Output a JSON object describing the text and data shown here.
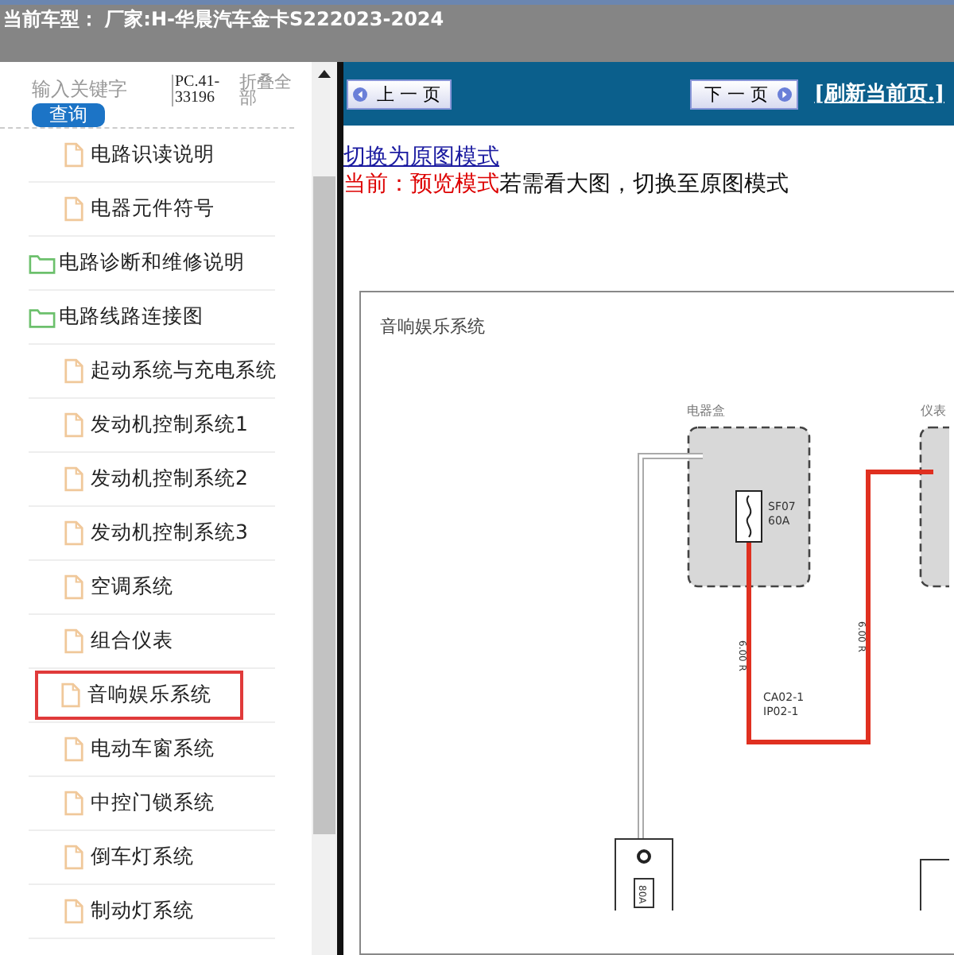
{
  "header": {
    "title": "当前车型： 厂家:H-华晨汽车金卡S222023-2024"
  },
  "sidebar": {
    "search": {
      "placeholder": "输入关键字",
      "button": "查询"
    },
    "code": "PC.41-33196",
    "collapse_all": "折叠全部",
    "tree": [
      {
        "kind": "file",
        "label": "电路识读说明",
        "selected": false
      },
      {
        "kind": "file",
        "label": "电器元件符号",
        "selected": false
      },
      {
        "kind": "folder",
        "label": "电路诊断和维修说明",
        "selected": false
      },
      {
        "kind": "folder",
        "label": "电路线路连接图",
        "selected": false,
        "children": [
          {
            "kind": "file",
            "label": "起动系统与充电系统",
            "selected": false
          },
          {
            "kind": "file",
            "label": "发动机控制系统1",
            "selected": false
          },
          {
            "kind": "file",
            "label": "发动机控制系统2",
            "selected": false
          },
          {
            "kind": "file",
            "label": "发动机控制系统3",
            "selected": false
          },
          {
            "kind": "file",
            "label": "空调系统",
            "selected": false
          },
          {
            "kind": "file",
            "label": "组合仪表",
            "selected": false
          },
          {
            "kind": "file",
            "label": "音响娱乐系统",
            "selected": true
          },
          {
            "kind": "file",
            "label": "电动车窗系统",
            "selected": false
          },
          {
            "kind": "file",
            "label": "中控门锁系统",
            "selected": false
          },
          {
            "kind": "file",
            "label": "倒车灯系统",
            "selected": false
          },
          {
            "kind": "file",
            "label": "制动灯系统",
            "selected": false
          }
        ]
      }
    ]
  },
  "toolbar": {
    "prev": "上 一 页",
    "next": "下 一 页",
    "refresh": "[刷新当前页.]"
  },
  "mode": {
    "switch_link": "切换为原图模式",
    "current": "当前：预览模式",
    "hint": "若需看大图，切换至原图模式"
  },
  "diagram": {
    "title": "音响娱乐系统",
    "box_1": "电器盒",
    "box_2": "仪表",
    "fuse": "SF07",
    "fuse_rating": "60A",
    "wire_1": "6.00 R",
    "wire_2": "6.00 R",
    "connector_1": "CA02-1",
    "connector_2": "IP02-1",
    "main_fuse": "80A"
  }
}
